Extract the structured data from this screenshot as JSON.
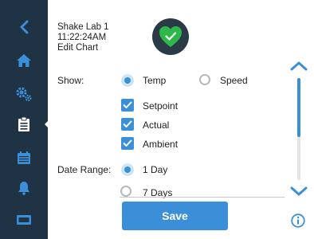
{
  "header": {
    "device_name": "Shake Lab 1",
    "time": "11:22:24AM",
    "page_title": "Edit Chart"
  },
  "sidebar": {
    "items": [
      {
        "icon": "back-chevron-icon"
      },
      {
        "icon": "home-icon"
      },
      {
        "icon": "settings-gears-icon"
      },
      {
        "icon": "clipboard-icon",
        "active": true
      },
      {
        "icon": "calendar-icon"
      },
      {
        "icon": "bell-icon"
      },
      {
        "icon": "card-icon"
      }
    ]
  },
  "form": {
    "show_label": "Show:",
    "show_options": [
      {
        "label": "Temp",
        "selected": true
      },
      {
        "label": "Speed",
        "selected": false
      }
    ],
    "series_options": [
      {
        "label": "Setpoint",
        "checked": true
      },
      {
        "label": "Actual",
        "checked": true
      },
      {
        "label": "Ambient",
        "checked": true
      }
    ],
    "date_range_label": "Date Range:",
    "date_range_options": [
      {
        "label": "1 Day",
        "selected": true
      },
      {
        "label": "7 Days",
        "selected": false
      }
    ]
  },
  "actions": {
    "save_label": "Save"
  },
  "colors": {
    "accent": "#3b8fd9",
    "sidebar": "#1f3344",
    "status_ok": "#2fb84a"
  }
}
